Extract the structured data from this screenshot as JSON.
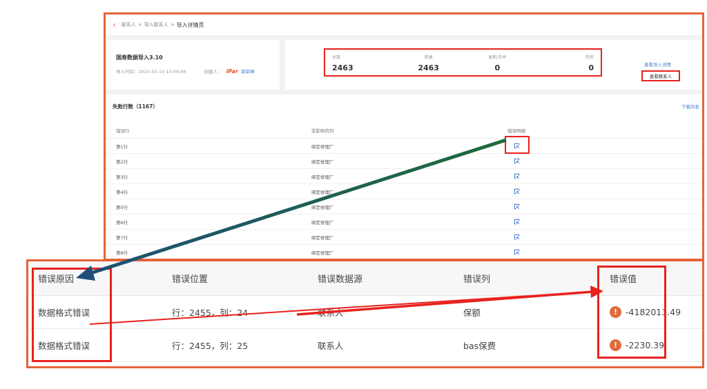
{
  "import_page": {
    "breadcrumb": [
      "联系人",
      "导入联系人",
      "导入详情页"
    ],
    "breadcrumb_separator": ">",
    "back_icon": "chevron-left-icon",
    "import_title": "国寿数据导入3.10",
    "import_time_label": "导入时间：2025-03-10 15:06:06",
    "creator_label": "创建人：",
    "creator_logo": "iPar",
    "creator_name": "郭荣峰",
    "stats": [
      {
        "label": "总数",
        "value": "2463"
      },
      {
        "label": "新建",
        "value": "2463"
      },
      {
        "label": "更新/合并",
        "value": "0"
      },
      {
        "label": "失败",
        "value": "0"
      }
    ],
    "view_detail_link": "查看导入详情",
    "view_contacts_button": "查看联系人",
    "failed_rows_title": "失败行数（1167）",
    "download_link": "下载列表",
    "columns": [
      "错误行",
      "受影响的列",
      "错误明细"
    ],
    "rows": [
      {
        "row": "第1行",
        "column": "绑定修理厂"
      },
      {
        "row": "第2行",
        "column": "绑定修理厂"
      },
      {
        "row": "第3行",
        "column": "绑定修理厂"
      },
      {
        "row": "第4行",
        "column": "绑定修理厂"
      },
      {
        "row": "第5行",
        "column": "绑定修理厂"
      },
      {
        "row": "第6行",
        "column": "绑定修理厂"
      },
      {
        "row": "第7行",
        "column": "绑定修理厂"
      },
      {
        "row": "第8行",
        "column": "绑定修理厂"
      }
    ],
    "detail_icon": "view-detail-icon"
  },
  "error_detail": {
    "columns": [
      "错误原因",
      "错误位置",
      "错误数据源",
      "错误列",
      "错误值"
    ],
    "rows": [
      {
        "reason": "数据格式错误",
        "position": "行：2455，列：24",
        "source": "联系人",
        "column": "保额",
        "value": "-4182013.49"
      },
      {
        "reason": "数据格式错误",
        "position": "行：2455，列：25",
        "source": "联系人",
        "column": "bas保费",
        "value": "-2230.39"
      }
    ],
    "warning_icon": "warning-circle-icon",
    "warning_glyph": "!"
  },
  "colors": {
    "frame_orange": "#e4643a",
    "highlight_red": "#e8211d",
    "link_blue": "#4a7fcf",
    "arrow_green": "#1f6b3a",
    "arrow_blue": "#1e4f78"
  }
}
